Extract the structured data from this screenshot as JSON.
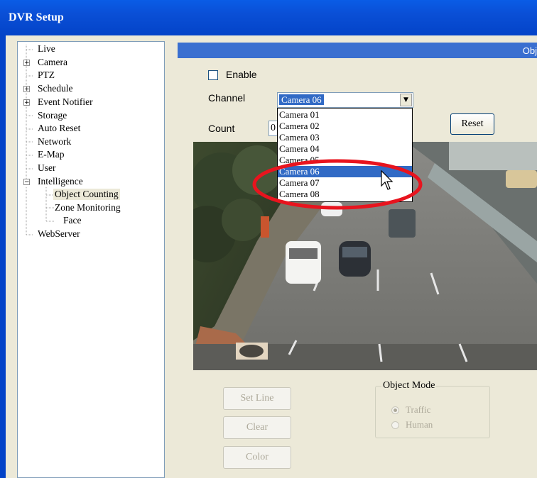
{
  "window": {
    "title": "DVR Setup"
  },
  "tree": {
    "items": [
      {
        "label": "Live"
      },
      {
        "label": "Camera",
        "expander": "+"
      },
      {
        "label": "PTZ"
      },
      {
        "label": "Schedule",
        "expander": "+"
      },
      {
        "label": "Event Notifier",
        "expander": "+"
      },
      {
        "label": "Storage"
      },
      {
        "label": "Auto Reset"
      },
      {
        "label": "Network"
      },
      {
        "label": "E-Map"
      },
      {
        "label": "User"
      },
      {
        "label": "Intelligence",
        "expander": "−"
      },
      {
        "label": "Object Counting",
        "selected": true
      },
      {
        "label": "Zone Monitoring"
      },
      {
        "label": "Face"
      },
      {
        "label": "WebServer"
      }
    ]
  },
  "panel": {
    "header": "Obj",
    "enable_label": "Enable",
    "channel_label": "Channel",
    "channel_value": "Camera 06",
    "count_label": "Count",
    "count_value": "0",
    "reset_label": "Reset"
  },
  "dropdown": {
    "options": [
      "Camera 01",
      "Camera 02",
      "Camera 03",
      "Camera 04",
      "Camera 05",
      "Camera 06",
      "Camera 07",
      "Camera 08"
    ],
    "selected_index": 5
  },
  "buttons": {
    "set_line": "Set Line",
    "clear": "Clear",
    "color": "Color"
  },
  "object_mode": {
    "title": "Object Mode",
    "options": [
      {
        "label": "Traffic",
        "checked": true
      },
      {
        "label": "Human",
        "checked": false
      }
    ]
  },
  "colors": {
    "titlebar": "#0a4fd6",
    "highlight": "#316ac5",
    "annotation": "#e8141e"
  }
}
